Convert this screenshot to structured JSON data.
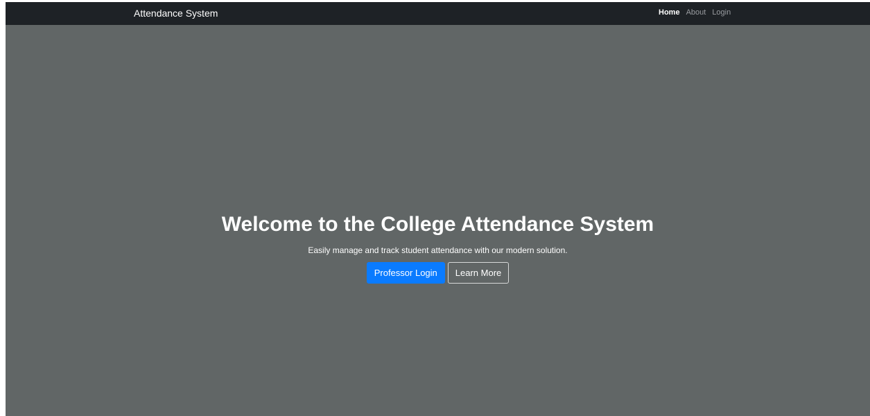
{
  "navbar": {
    "brand": "Attendance System",
    "links": [
      {
        "label": "Home",
        "active": true
      },
      {
        "label": "About",
        "active": false
      },
      {
        "label": "Login",
        "active": false
      }
    ]
  },
  "hero": {
    "title": "Welcome to the College Attendance System",
    "subtitle": "Easily manage and track student attendance with our modern solution.",
    "primary_button": "Professor Login",
    "secondary_button": "Learn More"
  },
  "colors": {
    "navbar_bg": "#1e2226",
    "hero_bg": "#616666",
    "primary": "#0a7bff",
    "text": "#ffffff",
    "nav_muted": "#9a9da1"
  }
}
